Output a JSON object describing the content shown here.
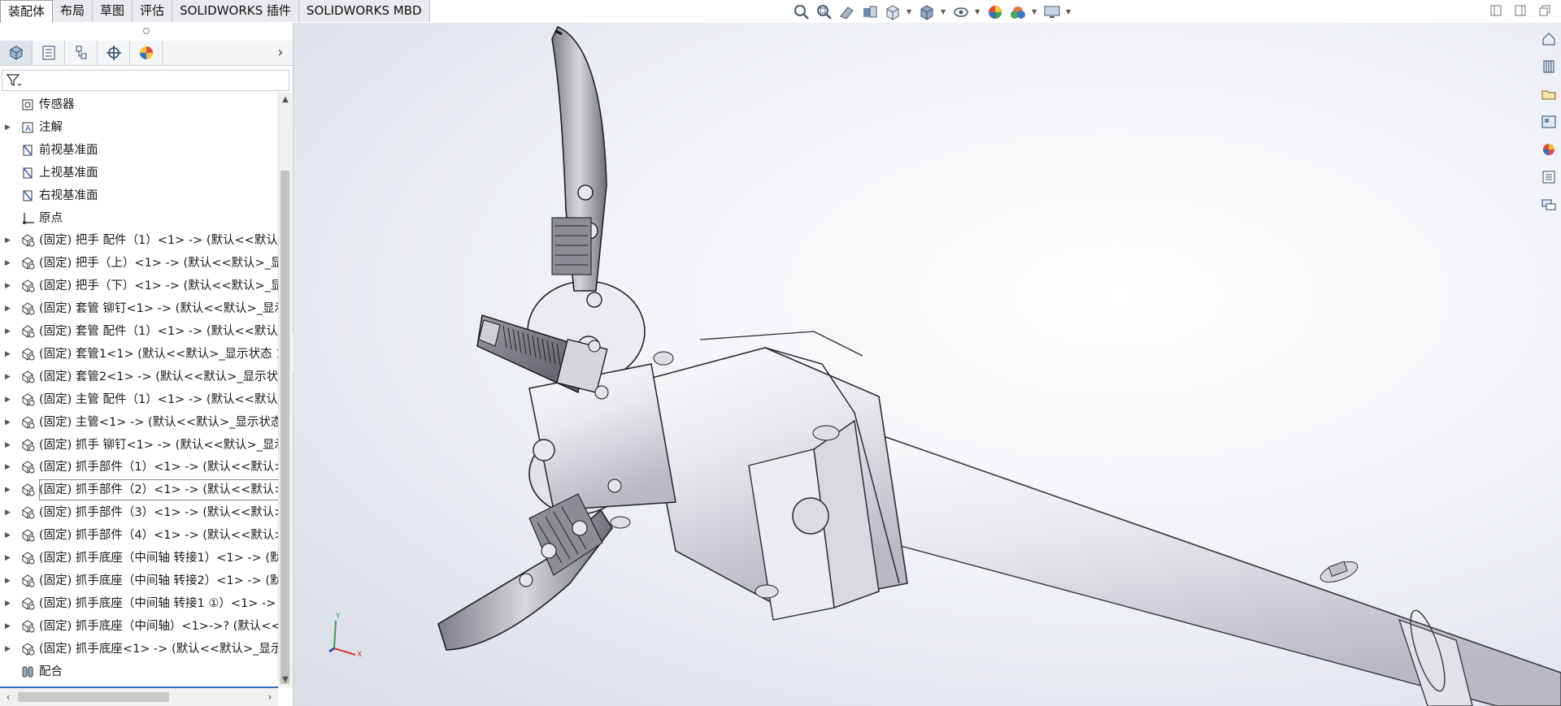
{
  "command_tabs": [
    {
      "label": "装配体",
      "active": true
    },
    {
      "label": "布局",
      "active": false
    },
    {
      "label": "草图",
      "active": false
    },
    {
      "label": "评估",
      "active": false
    },
    {
      "label": "SOLIDWORKS 插件",
      "active": false
    },
    {
      "label": "SOLIDWORKS MBD",
      "active": false
    }
  ],
  "heads_up_icons": [
    "zoom-to-fit-icon",
    "zoom-area-icon",
    "previous-view-icon",
    "section-view-icon",
    "view-orientation-icon",
    "display-style-icon",
    "hide-show-icon",
    "edit-appearance-icon",
    "apply-scene-icon",
    "view-settings-icon"
  ],
  "panel_tabs": [
    "featuremanager-icon",
    "propertymanager-icon",
    "configurationmanager-icon",
    "dimxpert-icon",
    "displaymanager-icon"
  ],
  "tree": [
    {
      "label": "传感器",
      "icon": "sensor-icon",
      "expandable": false
    },
    {
      "label": "注解",
      "icon": "annotation-icon",
      "expandable": true
    },
    {
      "label": "前视基准面",
      "icon": "plane-icon",
      "expandable": false
    },
    {
      "label": "上视基准面",
      "icon": "plane-icon",
      "expandable": false
    },
    {
      "label": "右视基准面",
      "icon": "plane-icon",
      "expandable": false
    },
    {
      "label": "原点",
      "icon": "origin-icon",
      "expandable": false
    },
    {
      "label": "(固定) 把手  配件（1）<1> -> (默认<<默认",
      "icon": "part-icon",
      "expandable": true
    },
    {
      "label": "(固定) 把手（上）<1> -> (默认<<默认>_显",
      "icon": "part-icon",
      "expandable": true
    },
    {
      "label": "(固定) 把手（下）<1> -> (默认<<默认>_显",
      "icon": "part-icon",
      "expandable": true
    },
    {
      "label": "(固定) 套管  铆钉<1> -> (默认<<默认>_显示",
      "icon": "part-icon",
      "expandable": true
    },
    {
      "label": "(固定) 套管  配件（1）<1> -> (默认<<默认",
      "icon": "part-icon",
      "expandable": true
    },
    {
      "label": "(固定) 套管1<1> (默认<<默认>_显示状态 1",
      "icon": "part-icon",
      "expandable": true
    },
    {
      "label": "(固定) 套管2<1> -> (默认<<默认>_显示状",
      "icon": "part-icon",
      "expandable": true
    },
    {
      "label": "(固定) 主管  配件（1）<1> -> (默认<<默认",
      "icon": "part-icon",
      "expandable": true
    },
    {
      "label": "(固定) 主管<1> -> (默认<<默认>_显示状态",
      "icon": "part-icon",
      "expandable": true
    },
    {
      "label": "(固定) 抓手  铆钉<1> -> (默认<<默认>_显示",
      "icon": "part-icon",
      "expandable": true
    },
    {
      "label": "(固定) 抓手部件（1）<1> -> (默认<<默认>",
      "icon": "part-icon",
      "expandable": true
    },
    {
      "label": "(固定) 抓手部件（2）<1> -> (默认<<默认>",
      "icon": "part-icon",
      "expandable": true,
      "selected": true
    },
    {
      "label": "(固定) 抓手部件（3）<1> -> (默认<<默认>",
      "icon": "part-icon",
      "expandable": true
    },
    {
      "label": "(固定) 抓手部件（4）<1> -> (默认<<默认>",
      "icon": "part-icon",
      "expandable": true
    },
    {
      "label": "(固定) 抓手底座（中间轴  转接1）<1> -> (默",
      "icon": "part-icon",
      "expandable": true
    },
    {
      "label": "(固定) 抓手底座（中间轴  转接2）<1> -> (默",
      "icon": "part-icon",
      "expandable": true
    },
    {
      "label": "(固定) 抓手底座（中间轴 转接1 ①）<1> ->",
      "icon": "part-icon",
      "expandable": true
    },
    {
      "label": "(固定) 抓手底座（中间轴）<1>->? (默认<<",
      "icon": "part-icon",
      "expandable": true
    },
    {
      "label": "(固定) 抓手底座<1> -> (默认<<默认>_显示",
      "icon": "part-icon",
      "expandable": true
    },
    {
      "label": "配合",
      "icon": "mates-icon",
      "expandable": false
    }
  ],
  "task_pane_icons": [
    "solidworks-resources-icon",
    "design-library-icon",
    "file-explorer-icon",
    "view-palette-icon",
    "appearances-icon",
    "custom-properties-icon",
    "forum-icon"
  ],
  "triad": {
    "x": "X",
    "y": "Y"
  },
  "colors": {
    "tab_bg": "#e9eaed",
    "selection_blue": "#2e6fbe",
    "model_body": "#e9e9ee"
  }
}
